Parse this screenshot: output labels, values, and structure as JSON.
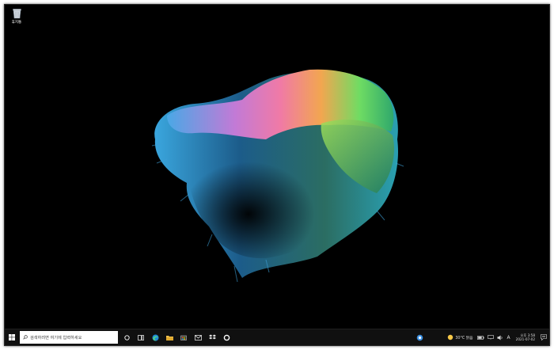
{
  "desktop": {
    "recycle_bin_label": "휴지통"
  },
  "taskbar": {
    "search_placeholder": "검색하려면 여기에 입력하세요",
    "pinned_apps": [
      "task-view",
      "widgets",
      "edge",
      "file-explorer",
      "store",
      "mail",
      "dropbox",
      "settings"
    ]
  },
  "tray": {
    "weather_text": "30°C 맑음",
    "ime_label": "A",
    "time": "오후 3:58",
    "date": "2021-07-02"
  },
  "colors": {
    "desktop_bg": "#000000",
    "taskbar_bg": "#101010",
    "search_bg": "#ffffff"
  }
}
